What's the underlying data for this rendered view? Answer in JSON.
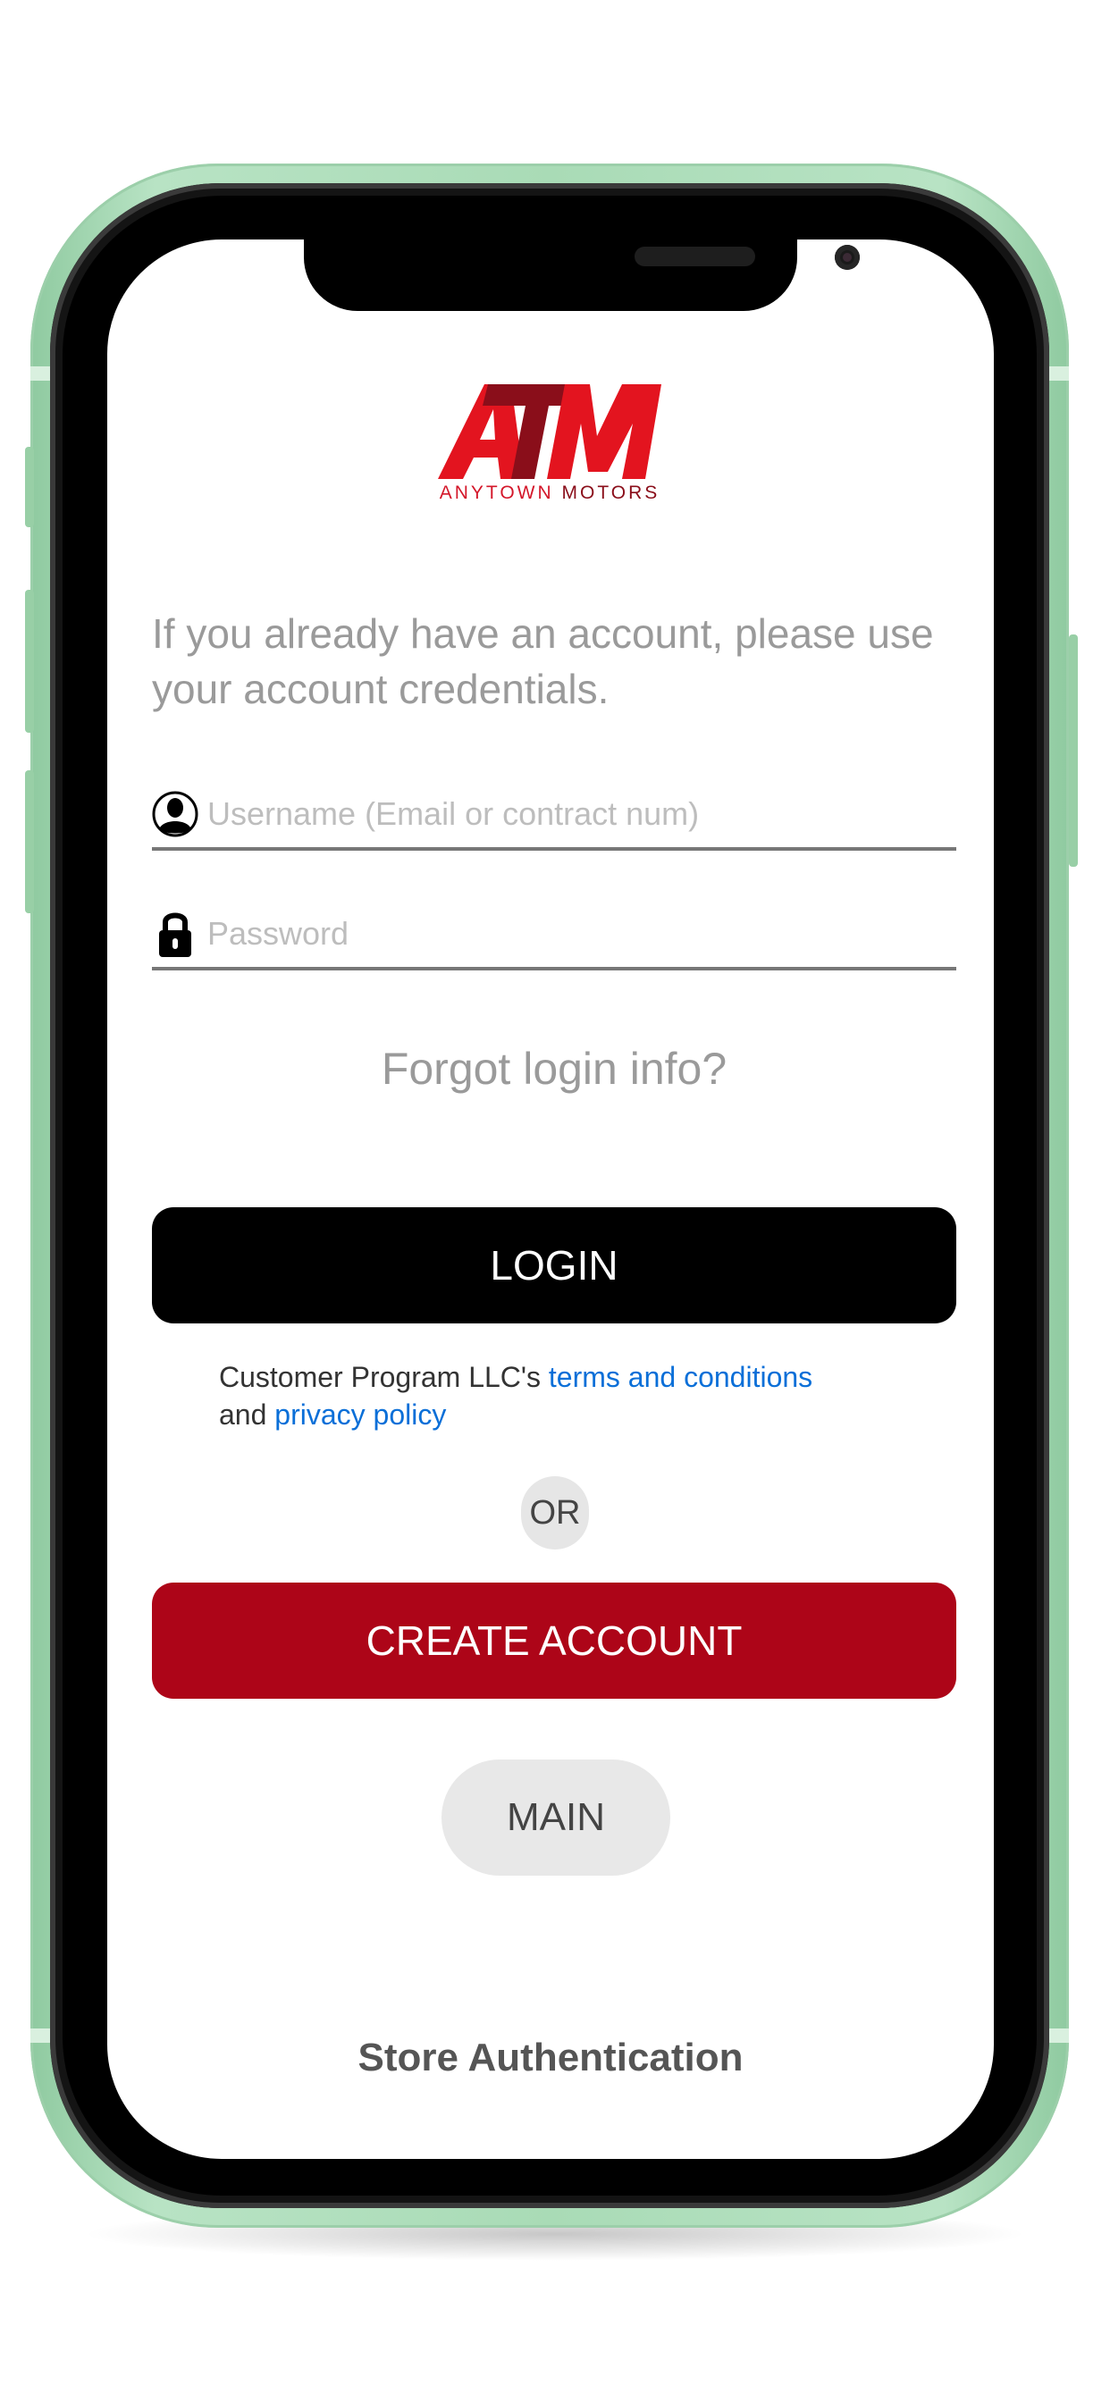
{
  "logo": {
    "mark_text": "ATM",
    "subtitle_part1": "ANYTOWN",
    "subtitle_part2": "MOTORS",
    "colors": {
      "primary": "#e3141f",
      "dark": "#8a0e1a"
    }
  },
  "login": {
    "intro_text": "If you already have an account, please use your account credentials.",
    "username_placeholder": "Username (Email or contract num)",
    "username_icon": "user-silhouette-icon",
    "password_placeholder": "Password",
    "password_icon": "lock-icon",
    "forgot_label": "Forgot login info?",
    "login_label": "LOGIN"
  },
  "terms": {
    "prefix": "Customer Program LLC's ",
    "terms_link": "terms and conditions",
    "and_text": "and ",
    "privacy_link": "privacy policy",
    "link_color": "#0a6fd8"
  },
  "divider_label": "OR",
  "create_account_label": "CREATE ACCOUNT",
  "main_label": "MAIN",
  "footer_title": "Store Authentication",
  "colors": {
    "login_button": "#000000",
    "create_button": "#ad0518",
    "phone_frame": "#a9dbb6"
  }
}
